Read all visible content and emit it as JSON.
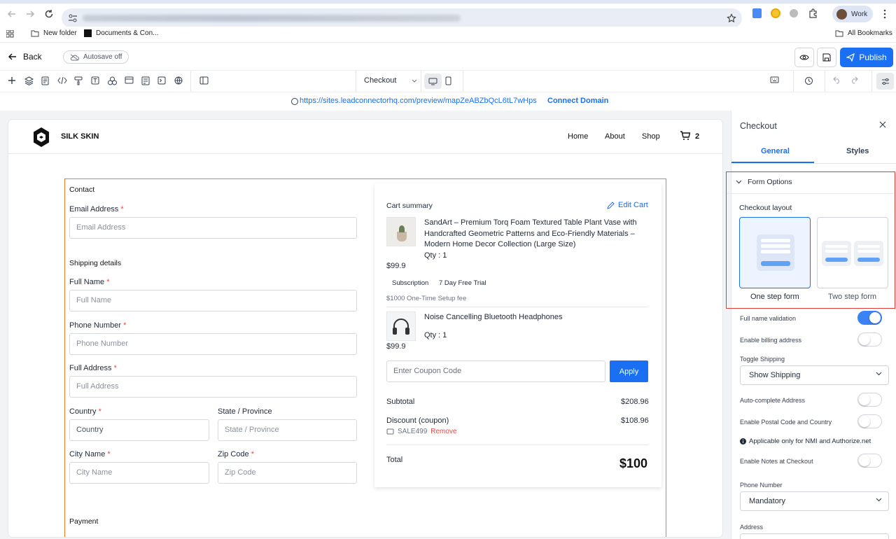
{
  "browser": {
    "profile_label": "Work",
    "bookmarks": [
      "New folder",
      "Documents & Con...",
      "All Bookmarks"
    ]
  },
  "header": {
    "back_label": "Back",
    "autosave_label": "Autosave off",
    "publish_label": "Publish"
  },
  "toolbar": {
    "page_select": "Checkout"
  },
  "preview": {
    "url": "https://sites.leadconnectorhq.com/preview/mapZeABZbQcL6tL7wHps",
    "connect_label": "Connect Domain"
  },
  "site": {
    "brand": "SILK SKIN",
    "nav": [
      "Home",
      "About",
      "Shop"
    ],
    "cart_count": "2"
  },
  "form": {
    "contact_title": "Contact",
    "email_label": "Email Address",
    "email_placeholder": "Email Address",
    "shipping_title": "Shipping details",
    "fullname_label": "Full Name",
    "fullname_placeholder": "Full Name",
    "phone_label": "Phone Number",
    "phone_placeholder": "Phone Number",
    "address_label": "Full Address",
    "address_placeholder": "Full Address",
    "country_label": "Country",
    "country_placeholder": "Country",
    "state_label": "State / Province",
    "state_placeholder": "State / Province",
    "city_label": "City Name",
    "city_placeholder": "City Name",
    "zip_label": "Zip Code",
    "zip_placeholder": "Zip Code",
    "payment_title": "Payment",
    "required_mark": "*"
  },
  "cart": {
    "title": "Cart summary",
    "edit_label": "Edit Cart",
    "items": [
      {
        "name": "SandArt – Premium Torq Foam Textured Table Plant Vase with Handcrafted Geometric Patterns and Eco-Friendly Materials – Modern Home Decor Collection (Large Size)",
        "qty": "Qty : 1",
        "price": "$99.9",
        "badges": [
          "Subscription",
          "7 Day Free Trial"
        ],
        "setup_fee": "$1000 One-Time Setup fee"
      },
      {
        "name": "Noise Cancelling Bluetooth Headphones",
        "qty": "Qty : 1",
        "price": "$99.9"
      }
    ],
    "coupon_placeholder": "Enter Coupon Code",
    "apply_label": "Apply",
    "subtotal_label": "Subtotal",
    "subtotal_value": "$208.96",
    "discount_label": "Discount (coupon)",
    "discount_value": "$108.96",
    "coupon_code": "SALE499",
    "remove_label": "Remove",
    "total_label": "Total",
    "total_value": "$100"
  },
  "panel": {
    "title": "Checkout",
    "tabs": [
      "General",
      "Styles"
    ],
    "section_title": "Form Options",
    "layout_label": "Checkout layout",
    "layout_options": [
      "One step form",
      "Two step form"
    ],
    "settings": [
      {
        "label": "Full name validation",
        "on": true
      },
      {
        "label": "Enable billing address",
        "on": false
      }
    ],
    "toggle_shipping_label": "Toggle Shipping",
    "toggle_shipping_value": "Show Shipping",
    "autocomplete_label": "Auto-complete Address",
    "postal_label": "Enable Postal Code and Country",
    "postal_note": "Applicable only for NMI and Authorize.net",
    "notes_label": "Enable Notes at Checkout",
    "phone_label": "Phone Number",
    "phone_value": "Mandatory",
    "address_label": "Address"
  },
  "colors": {
    "accent": "#1a6ff2",
    "selection_border": "#ef7d22",
    "panel_highlight": "#e53935",
    "remove": "#ef4444"
  }
}
